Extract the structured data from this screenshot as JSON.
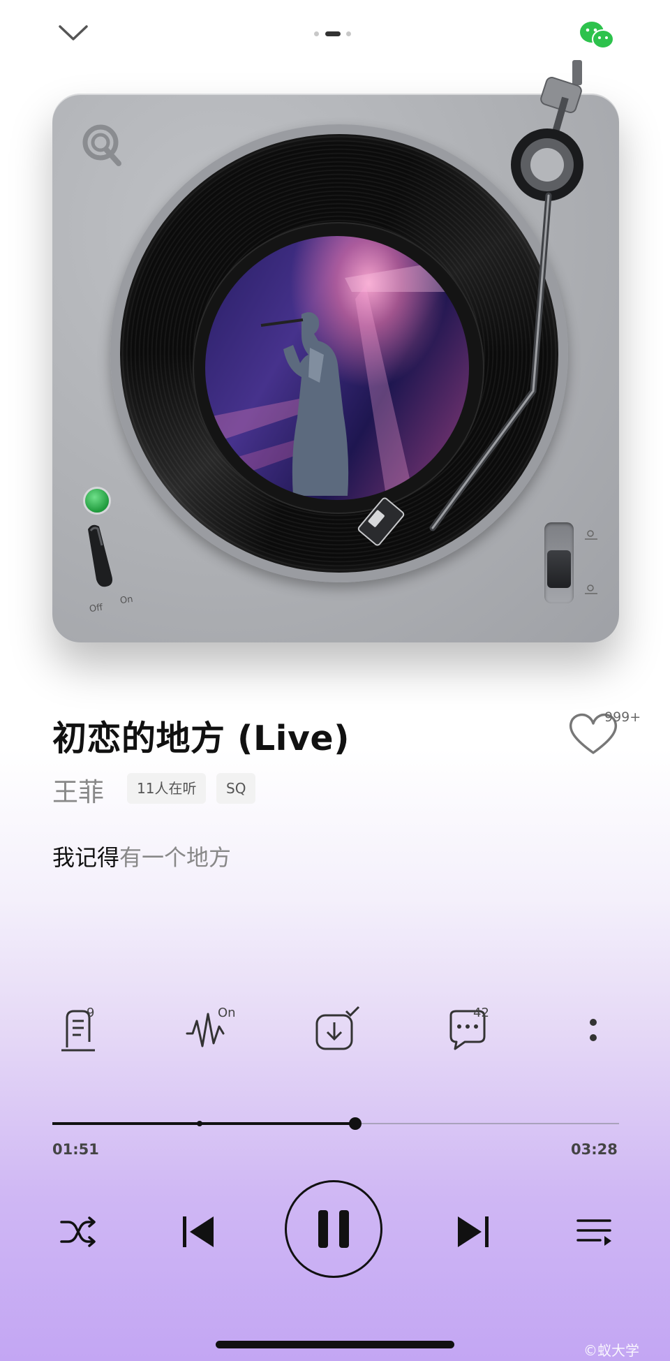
{
  "header": {
    "collapse_icon": "chevron-down-icon",
    "page_indicator": {
      "count": 3,
      "active_index": 1
    },
    "share_icon": "wechat-icon"
  },
  "player": {
    "turntable": {
      "logo_icon": "qq-music-logo",
      "power_switch": {
        "off_label": "Off",
        "on_label": "On",
        "state": "on"
      }
    },
    "song": {
      "title": "初恋的地方 (Live)",
      "artist": "王菲",
      "listeners_tag": "11人在听",
      "quality_tag": "SQ",
      "like_count": "999+"
    },
    "lyrics": {
      "sung": "我记得",
      "upcoming": "有一个地方"
    },
    "actions": {
      "lyrics_badge": "9",
      "sound_effect_badge": "On",
      "comments_badge": "42"
    },
    "progress": {
      "elapsed": "01:51",
      "total": "03:28",
      "fraction": 0.534,
      "buffered_fraction": 0.26
    },
    "state": "playing"
  },
  "colors": {
    "background_bottom": "#c3a6f3",
    "accent_text": "#111111",
    "muted_text": "#888888",
    "led_green": "#1f9a3c"
  },
  "watermark": "©蚁大学"
}
